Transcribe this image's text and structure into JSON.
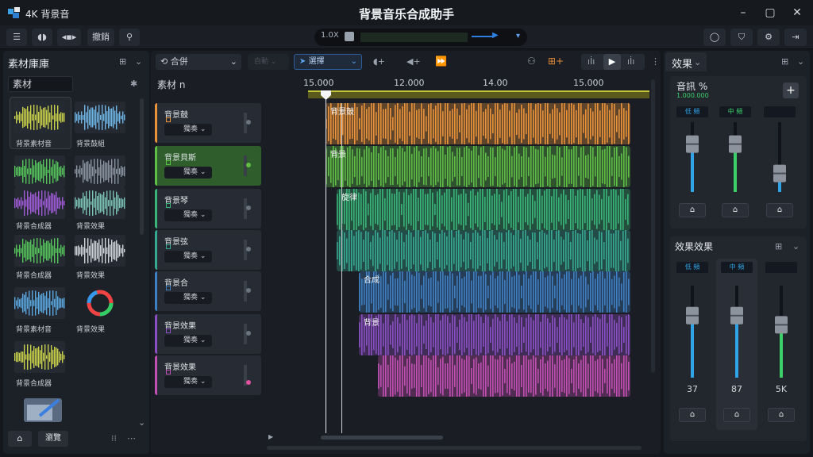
{
  "app": {
    "name": "4K 背景音",
    "window_title": "背景音乐合成助手"
  },
  "toolbar": {
    "edit_label": "撤銷",
    "zoom_label": "1.0X"
  },
  "library": {
    "tab_label": "素材庫庫",
    "search_value": "素材",
    "items": [
      {
        "label": "背景素材音",
        "color": "#c9d24a"
      },
      {
        "label": "背景鼓組",
        "color": "#6fb6e6"
      },
      {
        "label": "",
        "color": "#55c75a"
      },
      {
        "label": "",
        "color": "#8a93a0"
      },
      {
        "label": "背景合成器",
        "color": "#a05bd8"
      },
      {
        "label": "背景效果",
        "color": "#7cc2b7"
      },
      {
        "label": "背景合成器",
        "color": "#55c75a"
      },
      {
        "label": "背景效果",
        "color": "#d0d4da"
      },
      {
        "label": "背景素材音",
        "color": "#5aa9e0"
      },
      {
        "label": "背景效果",
        "color": "multicolor"
      },
      {
        "label": "背景合成器",
        "color": "#c9d24a"
      }
    ],
    "home_label": "",
    "footer_button": "瀏覽"
  },
  "tracks_panel": {
    "mode_select": "合併",
    "disabled_select": "自動",
    "tool_select": "選擇",
    "section_label": "素材 n"
  },
  "timeline": {
    "ticks": [
      "15.000",
      "12.000",
      "14.00",
      "15.000"
    ]
  },
  "tracks": [
    {
      "name": "背景鼓",
      "mode": "獨奏",
      "color": "#e8923a",
      "clip_label": "背景鼓"
    },
    {
      "name": "背景貝斯",
      "mode": "獨奏",
      "color": "#5fbe46",
      "clip_label": "背景"
    },
    {
      "name": "背景琴",
      "mode": "獨奏",
      "color": "#38b478",
      "clip_label": "旋律"
    },
    {
      "name": "背景弦",
      "mode": "獨奏",
      "color": "#36a890",
      "clip_label": ""
    },
    {
      "name": "背景合",
      "mode": "獨奏",
      "color": "#3f7fc4",
      "clip_label": "合成"
    },
    {
      "name": "背景效果",
      "mode": "獨奏",
      "color": "#8a4fc2",
      "clip_label": "背景"
    },
    {
      "name": "背景效果",
      "mode": "獨奏",
      "color": "#c24fb4",
      "clip_label": ""
    }
  ],
  "effects": {
    "tab_label": "效果",
    "section1_title": "音訊 %",
    "section1_sub": "1.000.000",
    "top_labels": [
      "低 頻",
      "中 頻",
      ""
    ],
    "section2_title": "效果效果",
    "bottom_labels": [
      "低 頻",
      "中 頻",
      ""
    ],
    "bottom_values": [
      "37",
      "87",
      "5K"
    ]
  },
  "colors": {
    "accent": "#2f7fe0",
    "meter_blue": "#2fa3e6",
    "meter_green": "#3ccf6a"
  }
}
